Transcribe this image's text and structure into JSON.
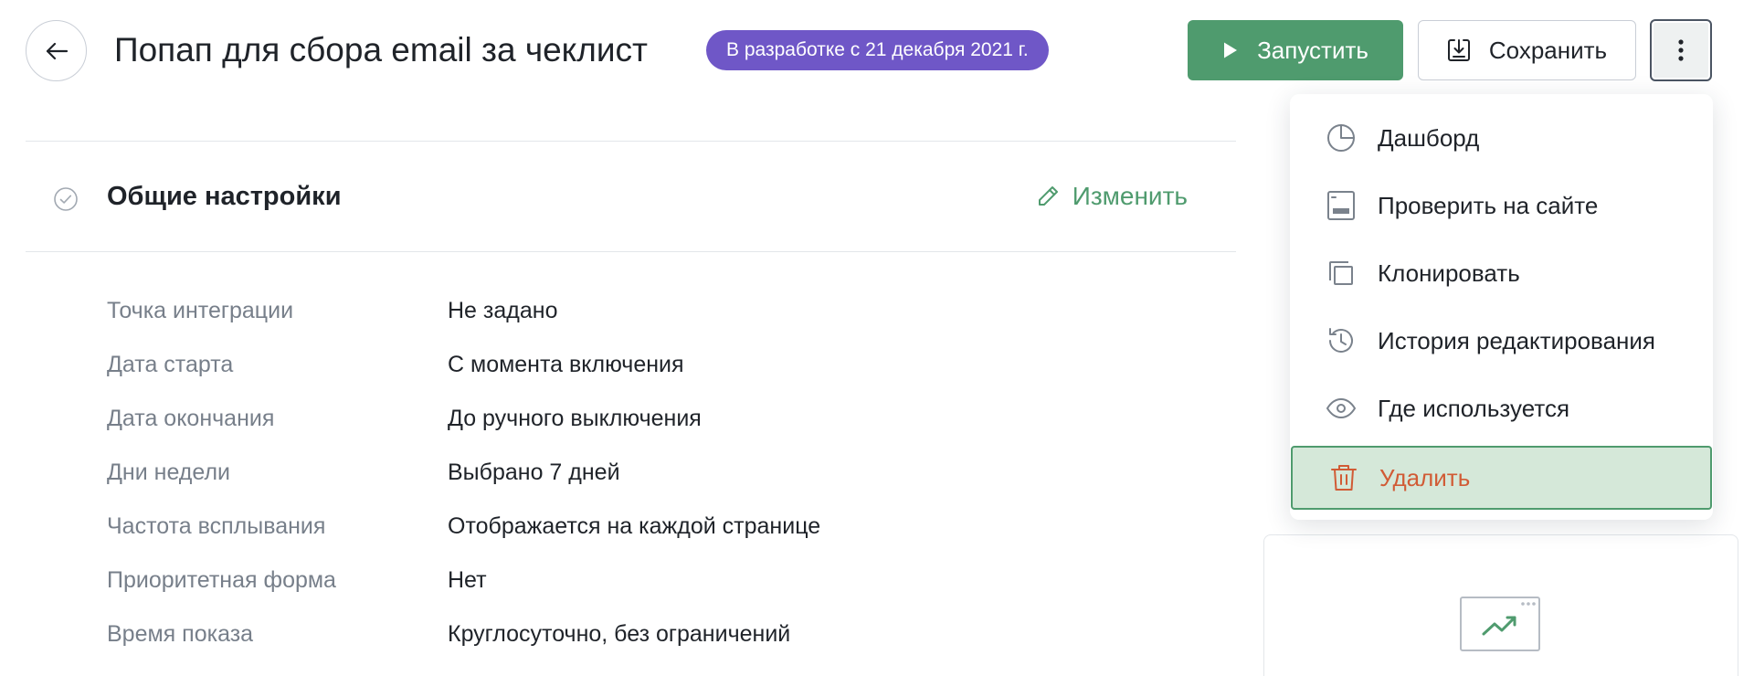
{
  "header": {
    "title": "Попап для сбора email за чеклист",
    "status_badge": "В разработке с 21 декабря 2021 г.",
    "run_label": "Запустить",
    "save_label": "Сохранить"
  },
  "section": {
    "title": "Общие настройки",
    "edit_label": "Изменить"
  },
  "settings": [
    {
      "label": "Точка интеграции",
      "value": "Не задано"
    },
    {
      "label": "Дата старта",
      "value": "С момента включения"
    },
    {
      "label": "Дата окончания",
      "value": "До ручного выключения"
    },
    {
      "label": "Дни недели",
      "value": "Выбрано 7 дней"
    },
    {
      "label": "Частота всплывания",
      "value": "Отображается на каждой странице"
    },
    {
      "label": "Приоритетная форма",
      "value": "Нет"
    },
    {
      "label": "Время показа",
      "value": "Круглосуточно, без ограничений"
    }
  ],
  "menu": {
    "items": [
      {
        "label": "Дашборд",
        "icon": "pie-chart-icon"
      },
      {
        "label": "Проверить на сайте",
        "icon": "browser-preview-icon"
      },
      {
        "label": "Клонировать",
        "icon": "copy-icon"
      },
      {
        "label": "История редактирования",
        "icon": "history-icon"
      },
      {
        "label": "Где используется",
        "icon": "eye-icon"
      },
      {
        "label": "Удалить",
        "icon": "trash-icon"
      }
    ]
  },
  "colors": {
    "primary_green": "#4f9b6e",
    "badge_purple": "#6f57c7",
    "danger_red": "#d15b35",
    "danger_highlight_bg": "#d5e8d9",
    "muted_label": "#777f8a"
  }
}
